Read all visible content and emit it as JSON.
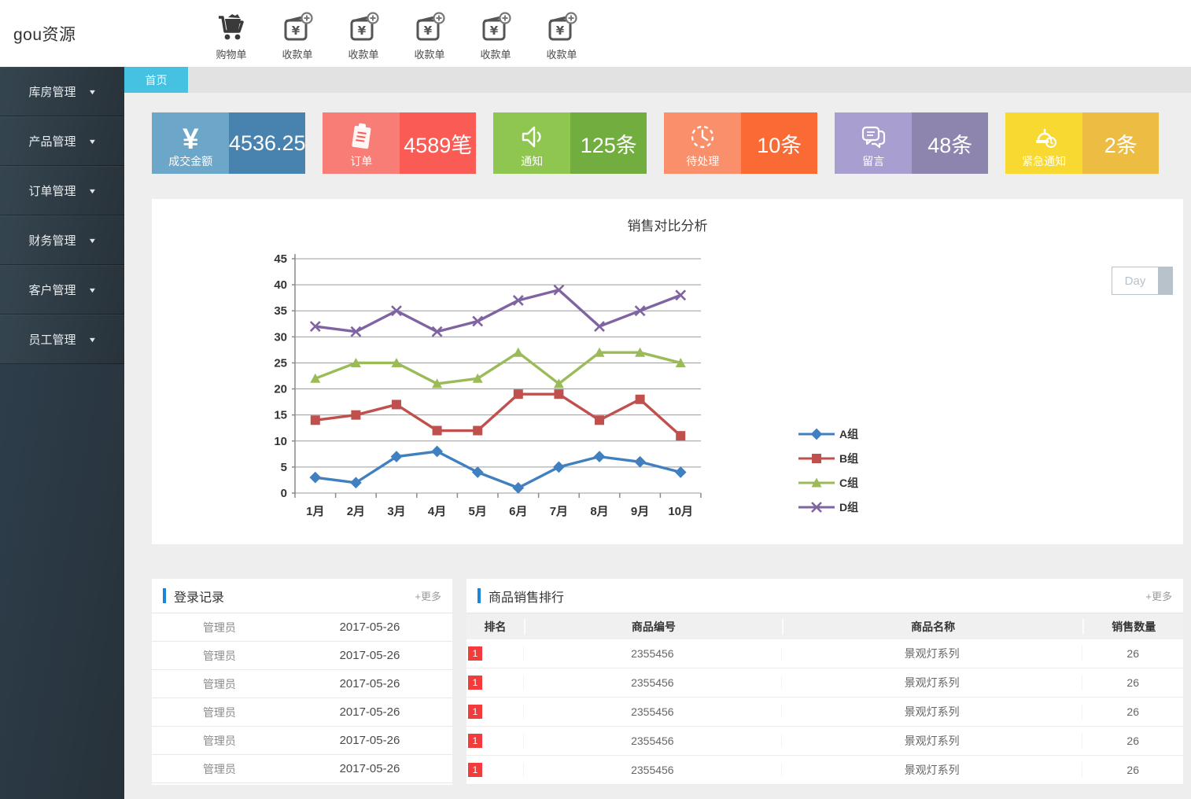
{
  "brand": "gou资源",
  "topnav": {
    "items": [
      {
        "icon": "cart-icon",
        "label": "购物单"
      },
      {
        "icon": "receipt-add-icon",
        "label": "收款单"
      },
      {
        "icon": "receipt-add-icon",
        "label": "收款单"
      },
      {
        "icon": "receipt-add-icon",
        "label": "收款单"
      },
      {
        "icon": "receipt-add-icon",
        "label": "收款单"
      },
      {
        "icon": "receipt-add-icon",
        "label": "收款单"
      }
    ]
  },
  "sidebar": {
    "items": [
      {
        "label": "库房管理"
      },
      {
        "label": "产品管理"
      },
      {
        "label": "订单管理"
      },
      {
        "label": "财务管理"
      },
      {
        "label": "客户管理"
      },
      {
        "label": "员工管理"
      }
    ]
  },
  "tabbar": {
    "active_tab": "首页"
  },
  "stat_cards": [
    {
      "icon": "yen-icon",
      "label": "成交金额",
      "value": "4536.25",
      "left_color": "#6ca7c9",
      "right_color": "#4783ae"
    },
    {
      "icon": "order-icon",
      "label": "订单",
      "value": "4589笔",
      "left_color": "#f87d77",
      "right_color": "#fa5b55"
    },
    {
      "icon": "speaker-icon",
      "label": "通知",
      "value": "125条",
      "left_color": "#8ec64f",
      "right_color": "#72ae3f"
    },
    {
      "icon": "clock-icon",
      "label": "待处理",
      "value": "10条",
      "left_color": "#f9906b",
      "right_color": "#f96a35"
    },
    {
      "icon": "message-icon",
      "label": "留言",
      "value": "48条",
      "left_color": "#a89ecf",
      "right_color": "#8d85ad"
    },
    {
      "icon": "alarm-icon",
      "label": "紧急通知",
      "value": "2条",
      "left_color": "#f8d932",
      "right_color": "#edbd43"
    }
  ],
  "chart_panel": {
    "title": "销售对比分析",
    "range_button": "Day"
  },
  "chart_data": {
    "type": "line",
    "title": "销售对比分析",
    "categories": [
      "1月",
      "2月",
      "3月",
      "4月",
      "5月",
      "6月",
      "7月",
      "8月",
      "9月",
      "10月"
    ],
    "series": [
      {
        "name": "A组",
        "marker": "diamond",
        "color": "#4180c0",
        "values": [
          3,
          2,
          7,
          8,
          4,
          1,
          5,
          7,
          6,
          4
        ]
      },
      {
        "name": "B组",
        "marker": "square",
        "color": "#c0504d",
        "values": [
          14,
          15,
          17,
          12,
          12,
          19,
          19,
          14,
          18,
          11
        ]
      },
      {
        "name": "C组",
        "marker": "triangle",
        "color": "#9bbb59",
        "values": [
          22,
          25,
          25,
          21,
          22,
          27,
          21,
          27,
          27,
          25
        ]
      },
      {
        "name": "D组",
        "marker": "x",
        "color": "#8064a2",
        "values": [
          32,
          31,
          35,
          31,
          33,
          37,
          39,
          32,
          35,
          38
        ]
      }
    ],
    "ylim": [
      0,
      45
    ],
    "ytick_step": 5,
    "xlabel": "",
    "ylabel": "",
    "grid": true,
    "legend_position": "right"
  },
  "login_panel": {
    "title": "登录记录",
    "more_label": "+更多",
    "rows": [
      {
        "user": "管理员",
        "date": "2017-05-26"
      },
      {
        "user": "管理员",
        "date": "2017-05-26"
      },
      {
        "user": "管理员",
        "date": "2017-05-26"
      },
      {
        "user": "管理员",
        "date": "2017-05-26"
      },
      {
        "user": "管理员",
        "date": "2017-05-26"
      },
      {
        "user": "管理员",
        "date": "2017-05-26"
      }
    ]
  },
  "sales_panel": {
    "title": "商品销售排行",
    "more_label": "+更多",
    "headers": [
      "排名",
      "商品编号",
      "商品名称",
      "销售数量"
    ],
    "rows": [
      {
        "rank": "1",
        "code": "2355456",
        "name": "景观灯系列",
        "qty": "26"
      },
      {
        "rank": "1",
        "code": "2355456",
        "name": "景观灯系列",
        "qty": "26"
      },
      {
        "rank": "1",
        "code": "2355456",
        "name": "景观灯系列",
        "qty": "26"
      },
      {
        "rank": "1",
        "code": "2355456",
        "name": "景观灯系列",
        "qty": "26"
      },
      {
        "rank": "1",
        "code": "2355456",
        "name": "景观灯系列",
        "qty": "26"
      }
    ]
  },
  "colors": {
    "tab_blue": "#45c1e1",
    "panel_accent_blue": "#1b86d9",
    "rank_badge_red": "#f23c3c",
    "sidebar_dark": "#2c3a44"
  }
}
